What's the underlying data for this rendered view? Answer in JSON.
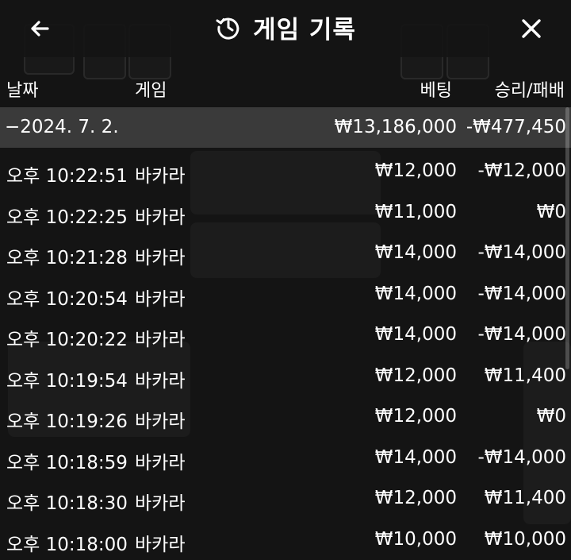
{
  "header": {
    "title": "게임 기록",
    "back_icon": "arrow-left-icon",
    "history_icon": "history-clock-icon",
    "close_icon": "close-icon"
  },
  "columns": {
    "date": "날짜",
    "game": "게임",
    "bet": "베팅",
    "result": "승리/패배"
  },
  "summary": {
    "date": "−2024. 7. 2.",
    "bet": "₩13,186,000",
    "result": "-₩477,450"
  },
  "rows": [
    {
      "time": "오후 10:22:51",
      "game": "바카라",
      "bet": "₩12,000",
      "result": "-₩12,000"
    },
    {
      "time": "오후 10:22:25",
      "game": "바카라",
      "bet": "₩11,000",
      "result": "₩0"
    },
    {
      "time": "오후 10:21:28",
      "game": "바카라",
      "bet": "₩14,000",
      "result": "-₩14,000"
    },
    {
      "time": "오후 10:20:54",
      "game": "바카라",
      "bet": "₩14,000",
      "result": "-₩14,000"
    },
    {
      "time": "오후 10:20:22",
      "game": "바카라",
      "bet": "₩14,000",
      "result": "-₩14,000"
    },
    {
      "time": "오후 10:19:54",
      "game": "바카라",
      "bet": "₩12,000",
      "result": "₩11,400"
    },
    {
      "time": "오후 10:19:26",
      "game": "바카라",
      "bet": "₩12,000",
      "result": "₩0"
    },
    {
      "time": "오후 10:18:59",
      "game": "바카라",
      "bet": "₩14,000",
      "result": "-₩14,000"
    },
    {
      "time": "오후 10:18:30",
      "game": "바카라",
      "bet": "₩12,000",
      "result": "₩11,400"
    },
    {
      "time": "오후 10:18:00",
      "game": "바카라",
      "bet": "₩10,000",
      "result": "₩10,000"
    }
  ],
  "colors": {
    "background": "#141414",
    "summary_row": "#3a3a3a",
    "text": "#ffffff"
  }
}
